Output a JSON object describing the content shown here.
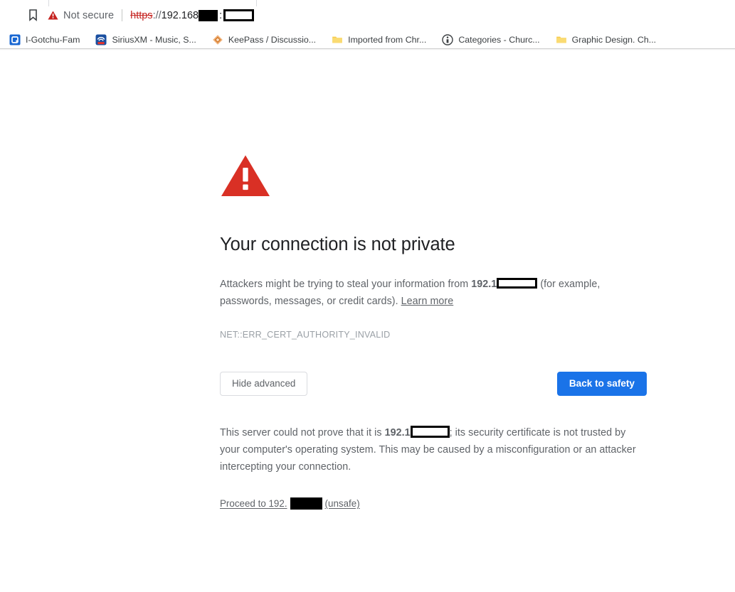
{
  "browser": {
    "bookmark_star_icon": "bookmark-outline-icon",
    "omnibox": {
      "security_icon": "warning-triangle-icon",
      "security_label": "Not secure",
      "url_scheme": "https",
      "url_separator": "://",
      "url_host": "192.168",
      "url_colon": ":",
      "redacted_octet": "",
      "redacted_port": ""
    },
    "bookmarks": [
      {
        "label": "I-Gotchu-Fam",
        "icon": "app-square-icon"
      },
      {
        "label": "SiriusXM - Music, S...",
        "icon": "siriusxm-icon"
      },
      {
        "label": "KeePass / Discussio...",
        "icon": "keepass-diamond-icon"
      },
      {
        "label": "Imported from Chr...",
        "icon": "folder-icon"
      },
      {
        "label": "Categories - Churc...",
        "icon": "info-circle-icon"
      },
      {
        "label": "Graphic Design. Ch...",
        "icon": "folder-icon"
      }
    ]
  },
  "interstitial": {
    "warning_icon": "warning-triangle-icon",
    "heading": "Your connection is not private",
    "paragraph": {
      "lead": "Attackers might be trying to steal your information from ",
      "host_bold": "192.1",
      "after_redaction": " (for example, passwords, messages, or credit cards). ",
      "learn_more": "Learn more"
    },
    "error_code": "NET::ERR_CERT_AUTHORITY_INVALID",
    "buttons": {
      "hide_advanced": "Hide advanced",
      "back_to_safety": "Back to safety"
    },
    "advanced": {
      "lead": "This server could not prove that it is ",
      "host_bold": "192.1",
      "rest": "; its security certificate is not trusted by your computer's operating system. This may be caused by a misconfiguration or an attacker intercepting your connection."
    },
    "proceed_link": {
      "prefix": "Proceed to 192.",
      "suffix": "(unsafe)"
    },
    "colors": {
      "warning_red": "#d93025",
      "primary_blue": "#1a73e8",
      "heading_text": "#202124",
      "body_text": "#5f6368",
      "error_code_text": "#9aa0a6",
      "redaction": "#000000"
    }
  }
}
